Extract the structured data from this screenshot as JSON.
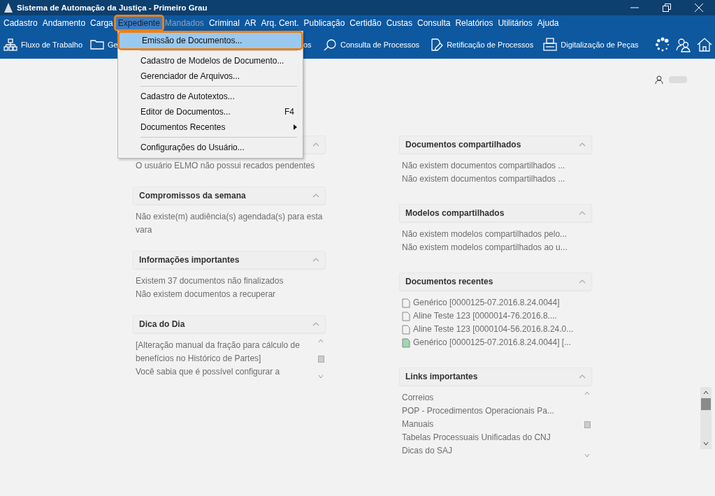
{
  "window": {
    "title": "Sistema de Automação da Justiça - Primeiro Grau"
  },
  "menu": [
    {
      "label": "Cadastro",
      "selected": false,
      "disabled": false
    },
    {
      "label": "Andamento",
      "selected": false,
      "disabled": false
    },
    {
      "label": "Carga",
      "selected": false,
      "disabled": false
    },
    {
      "label": "Expediente",
      "selected": true,
      "disabled": false
    },
    {
      "label": "Mandados",
      "selected": false,
      "disabled": true
    },
    {
      "label": "Criminal",
      "selected": false,
      "disabled": false
    },
    {
      "label": "AR",
      "selected": false,
      "disabled": false
    },
    {
      "label": "Arq. Cent.",
      "selected": false,
      "disabled": false
    },
    {
      "label": "Publicação",
      "selected": false,
      "disabled": false
    },
    {
      "label": "Certidão",
      "selected": false,
      "disabled": false
    },
    {
      "label": "Custas",
      "selected": false,
      "disabled": false
    },
    {
      "label": "Consulta",
      "selected": false,
      "disabled": false
    },
    {
      "label": "Relatórios",
      "selected": false,
      "disabled": false
    },
    {
      "label": "Utilitários",
      "selected": false,
      "disabled": false
    },
    {
      "label": "Ajuda",
      "selected": false,
      "disabled": false
    }
  ],
  "toolbar": [
    {
      "label": "Fluxo de Trabalho",
      "kind": "flow"
    },
    {
      "label": "Ge",
      "kind": "folder"
    },
    {
      "label": "os",
      "kind": "hidden"
    },
    {
      "label": "Consulta de Processos",
      "kind": "search"
    },
    {
      "label": "Retificação de Processos",
      "kind": "edit"
    },
    {
      "label": "Digitalização de Peças",
      "kind": "scanner"
    }
  ],
  "dropdown": [
    {
      "label": "Emissão de Documentos...",
      "selected": true,
      "separator_before": false,
      "submenu": false
    },
    {
      "label": "Cadastro de Modelos de Documento...",
      "selected": false,
      "separator_before": true,
      "submenu": false
    },
    {
      "label": "Gerenciador de Arquivos...",
      "selected": false,
      "separator_before": false,
      "submenu": false
    },
    {
      "label": "Cadastro de Autotextos...",
      "selected": false,
      "separator_before": true,
      "submenu": false
    },
    {
      "label": "Editor de Documentos...",
      "shortcut": "F4",
      "selected": false,
      "separator_before": false,
      "submenu": false
    },
    {
      "label": "Documentos Recentes",
      "selected": false,
      "separator_before": false,
      "submenu": true
    },
    {
      "label": "Configurações do Usuário...",
      "selected": false,
      "separator_before": true,
      "submenu": false
    }
  ],
  "left_panels": [
    {
      "lines": [
        "O usuário ELMO não possui recados pendentes"
      ]
    },
    {
      "title": "Compromissos da semana",
      "lines": [
        "Não existe(m) audiência(s) agendada(s) para esta vara"
      ]
    },
    {
      "title": "Informações importantes",
      "lines": [
        "Existem 37 documentos não finalizados",
        "Não existem documentos a recuperar"
      ]
    },
    {
      "title": "Dica do Dia",
      "scroll": true,
      "lines": [
        "[Alteração manual da fração para cálculo de benefícios no Histórico de Partes]",
        "Você sabia que é possível configurar a"
      ]
    }
  ],
  "right_panels": [
    {
      "title": "Documentos compartilhados",
      "lines": [
        "Não existem documentos compartilhados ...",
        "Não existem documentos compartilhados ..."
      ]
    },
    {
      "title": "Modelos compartilhados",
      "lines": [
        "Não existem modelos compartilhados pelo...",
        "Não existem modelos compartilhados ao u..."
      ]
    },
    {
      "title": "Documentos recentes",
      "kind": "docs",
      "lines": [
        "Genérico [0000125-07.2016.8.24.0044]",
        "Aline Teste 123 [0000014-76.2016.8....",
        "Aline Teste 123 [0000104-56.2016.8.24.0...",
        "Genérico [0000125-07.2016.8.24.0044] [..."
      ]
    },
    {
      "title": "Links importantes",
      "scroll": true,
      "lines": [
        "Correios",
        "POP - Procedimentos Operacionais Pa...",
        "Manuais",
        "Tabelas Processuais Unificadas do CNJ",
        "Dicas do SAJ"
      ]
    }
  ]
}
